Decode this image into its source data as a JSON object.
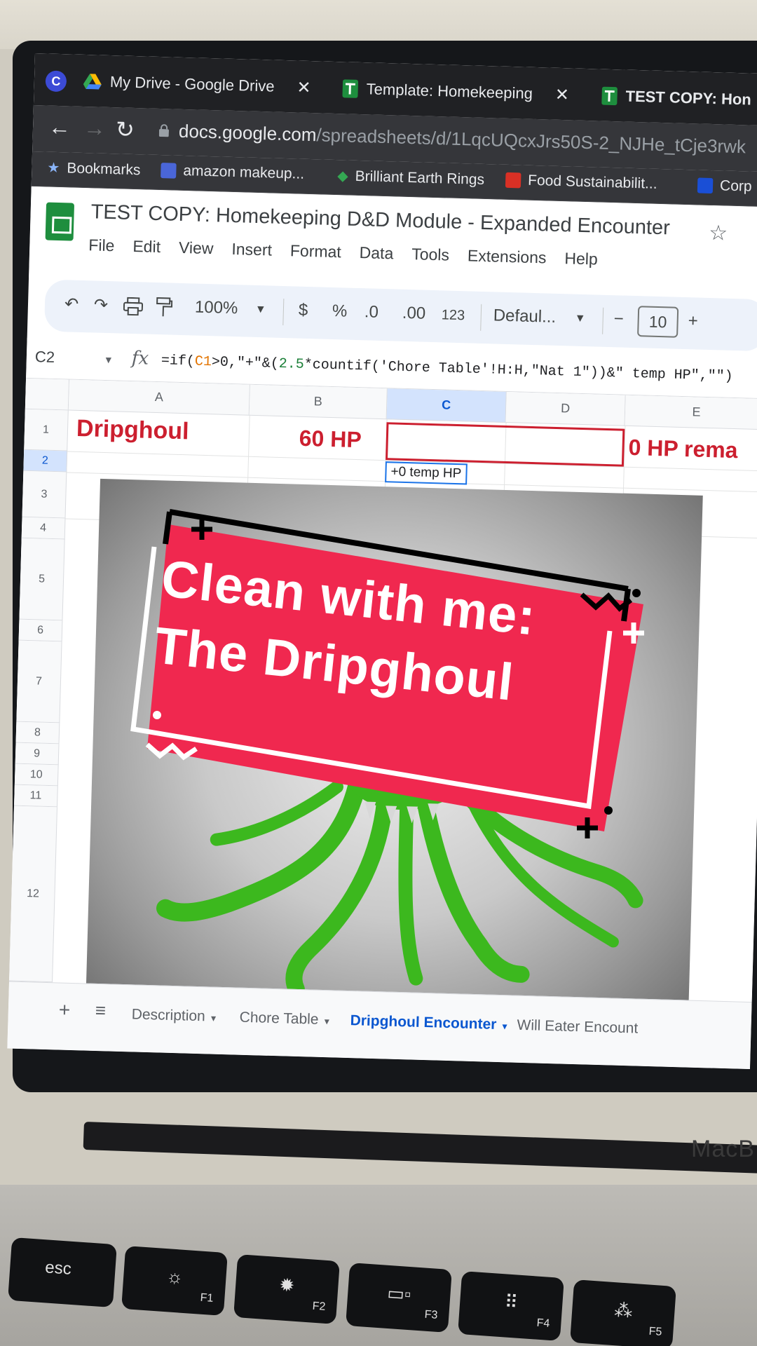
{
  "browser": {
    "profile_letter": "C",
    "tabs": [
      {
        "label": "My Drive - Google Drive",
        "icon": "google-drive-icon"
      },
      {
        "label": "Template: Homekeeping",
        "icon": "google-sheets-icon"
      },
      {
        "label": "TEST COPY: Hon",
        "icon": "google-sheets-icon"
      }
    ],
    "close_glyph": "✕",
    "url_host": "docs.google.com",
    "url_path": "/spreadsheets/d/1LqcUQcxJrs50S-2_NJHe_tCje3rwk",
    "bookmarks": [
      {
        "label": "Bookmarks",
        "icon": "star-icon"
      },
      {
        "label": "amazon makeup...",
        "icon": "bookmark-favicon"
      },
      {
        "label": "Brilliant Earth Rings",
        "icon": "bookmark-favicon"
      },
      {
        "label": "Food Sustainabilit...",
        "icon": "bookmark-favicon"
      },
      {
        "label": "Corp",
        "icon": "bookmark-favicon"
      }
    ]
  },
  "sheets": {
    "title": "TEST COPY: Homekeeping D&D Module - Expanded Encounter",
    "menu": [
      "File",
      "Edit",
      "View",
      "Insert",
      "Format",
      "Data",
      "Tools",
      "Extensions",
      "Help"
    ],
    "toolbar": {
      "zoom": "100%",
      "currency": "$",
      "percent": "%",
      "dec_decrease": ".0",
      "dec_increase": ".00",
      "number_format": "123",
      "font": "Defaul...",
      "minus": "−",
      "font_size": "10",
      "plus": "+"
    },
    "name_box": "C2",
    "formula": {
      "p1": "=if(",
      "ref": "C1",
      "p2": ">0,\"+\"&(",
      "num": "2.5",
      "p3": "*countif('Chore Table'!H:H,\"Nat 1\"))&\" temp HP\",\"\")"
    },
    "columns": [
      "A",
      "B",
      "C",
      "D",
      "E"
    ],
    "rows": [
      "1",
      "2",
      "3",
      "4",
      "5",
      "6",
      "7",
      "8",
      "9",
      "10",
      "11",
      "12"
    ],
    "cells": {
      "a1": "Dripghoul",
      "b1": "60 HP",
      "e1": "0 HP rema"
    },
    "tooltip": "+0 temp HP",
    "sheet_tabs": [
      {
        "label": "Description"
      },
      {
        "label": "Chore Table"
      },
      {
        "label": "Dripghoul Encounter"
      },
      {
        "label": "Will Eater Encount"
      }
    ]
  },
  "overlay": {
    "line1": "Clean with me:",
    "line2": "The Dripghoul"
  },
  "laptop": {
    "brand": "MacB",
    "keys": [
      {
        "label": "esc",
        "icon": ""
      },
      {
        "label": "F1",
        "icon": "brightness-down-icon"
      },
      {
        "label": "F2",
        "icon": "brightness-up-icon"
      },
      {
        "label": "F3",
        "icon": "mission-control-icon"
      },
      {
        "label": "F4",
        "icon": "launchpad-icon"
      },
      {
        "label": "F5",
        "icon": "keyboard-light-icon"
      }
    ]
  },
  "colors": {
    "sticker_pink": "#f0284f",
    "cell_red": "#cc1f2f",
    "sheets_green": "#1e8e3e",
    "active_tab_blue": "#0b57d0",
    "monster_green": "#3cb81e"
  }
}
